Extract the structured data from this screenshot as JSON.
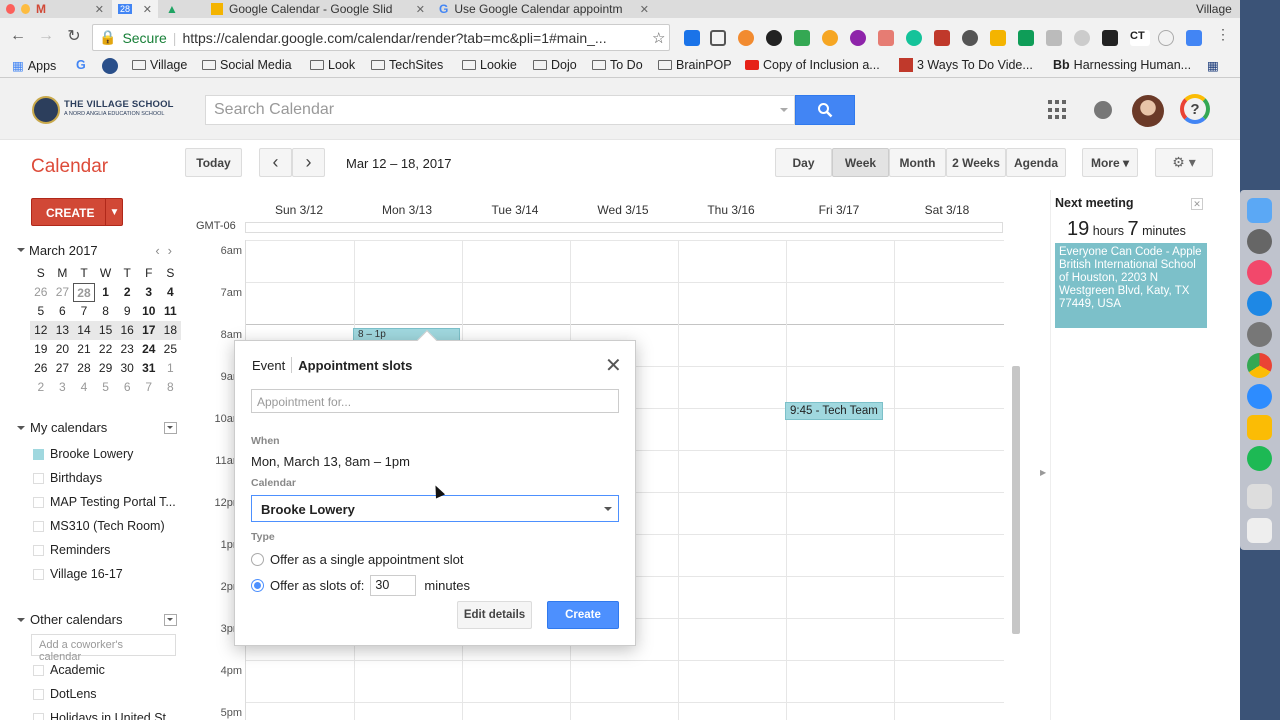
{
  "browser": {
    "tabs": [
      {
        "label": "",
        "icon": "gmail-icon"
      },
      {
        "label": "",
        "icon": "calendar-tab-icon"
      },
      {
        "label": "",
        "icon": "drive-icon"
      },
      {
        "label": "Google Calendar - Google Slid",
        "icon": "slides-icon"
      },
      {
        "label": "Use Google Calendar appointm",
        "icon": "google-icon"
      }
    ],
    "profile": "Village",
    "secure_label": "Secure",
    "url": "https://calendar.google.com/calendar/render?tab=mc&pli=1#main_...",
    "bookmarks": [
      "Apps",
      "Village",
      "Social Media",
      "Look",
      "TechSites",
      "Lookie",
      "Dojo",
      "To Do",
      "BrainPOP",
      "Copy of Inclusion a...",
      "3 Ways To Do Vide...",
      "Harnessing Human..."
    ]
  },
  "header": {
    "school_name": "THE VILLAGE SCHOOL",
    "school_sub": "A NORD ANGLIA EDUCATION SCHOOL",
    "search_placeholder": "Search Calendar"
  },
  "toolbar": {
    "title": "Calendar",
    "today": "Today",
    "prev": "‹",
    "next": "›",
    "date_range": "Mar 12 – 18, 2017",
    "views": [
      "Day",
      "Week",
      "Month",
      "2 Weeks",
      "Agenda"
    ],
    "more": "More ▾",
    "settings": "⚙ ▾"
  },
  "sidebar": {
    "create": "CREATE",
    "create_arrow": "▼",
    "mini_month": "March 2017",
    "weekdays": [
      "S",
      "M",
      "T",
      "W",
      "T",
      "F",
      "S"
    ],
    "weeks": [
      [
        "26",
        "27",
        "28",
        "1",
        "2",
        "3",
        "4"
      ],
      [
        "5",
        "6",
        "7",
        "8",
        "9",
        "10",
        "11"
      ],
      [
        "12",
        "13",
        "14",
        "15",
        "16",
        "17",
        "18"
      ],
      [
        "19",
        "20",
        "21",
        "22",
        "23",
        "24",
        "25"
      ],
      [
        "26",
        "27",
        "28",
        "29",
        "30",
        "31",
        "1"
      ],
      [
        "2",
        "3",
        "4",
        "5",
        "6",
        "7",
        "8"
      ]
    ],
    "my_calendars_title": "My calendars",
    "my_calendars": [
      "Brooke Lowery",
      "Birthdays",
      "MAP Testing Portal T...",
      "MS310 (Tech Room)",
      "Reminders",
      "Village 16-17"
    ],
    "other_calendars_title": "Other calendars",
    "add_coworker_placeholder": "Add a coworker's calendar",
    "other_calendars": [
      "Academic",
      "DotLens",
      "Holidays in United St..."
    ]
  },
  "grid": {
    "timezone": "GMT-06",
    "days": [
      "Sun 3/12",
      "Mon 3/13",
      "Tue 3/14",
      "Wed 3/15",
      "Thu 3/16",
      "Fri 3/17",
      "Sat 3/18"
    ],
    "hours": [
      "6am",
      "7am",
      "8am",
      "9am",
      "10am",
      "11am",
      "12pm",
      "1pm",
      "2pm",
      "3pm",
      "4pm",
      "5pm"
    ],
    "events": [
      {
        "label": "8 – 1p",
        "day": "Mon 3/13"
      },
      {
        "label": "9:45 - Tech Team",
        "day": "Fri 3/17"
      }
    ]
  },
  "next_meeting": {
    "title": "Next meeting",
    "hours": "19",
    "hours_label": "hours",
    "minutes": "7",
    "minutes_label": "minutes",
    "event_title": "Everyone Can Code - Apple",
    "event_location": "British International School of Houston, 2203 N Westgreen Blvd, Katy, TX 77449, USA"
  },
  "dialog": {
    "tab_event": "Event",
    "tab_slots": "Appointment slots",
    "appointment_placeholder": "Appointment for...",
    "when_label": "When",
    "when_value": "Mon, March 13, 8am – 1pm",
    "calendar_label": "Calendar",
    "calendar_value": "Brooke Lowery",
    "type_label": "Type",
    "opt_single": "Offer as a single appointment slot",
    "opt_slots": "Offer as slots of:",
    "slot_minutes": "30",
    "minutes_label": "minutes",
    "edit_details": "Edit details",
    "create": "Create"
  },
  "colors": {
    "brand_red": "#dd4b39",
    "blue": "#4285f4",
    "event_teal": "#a0d8df"
  }
}
